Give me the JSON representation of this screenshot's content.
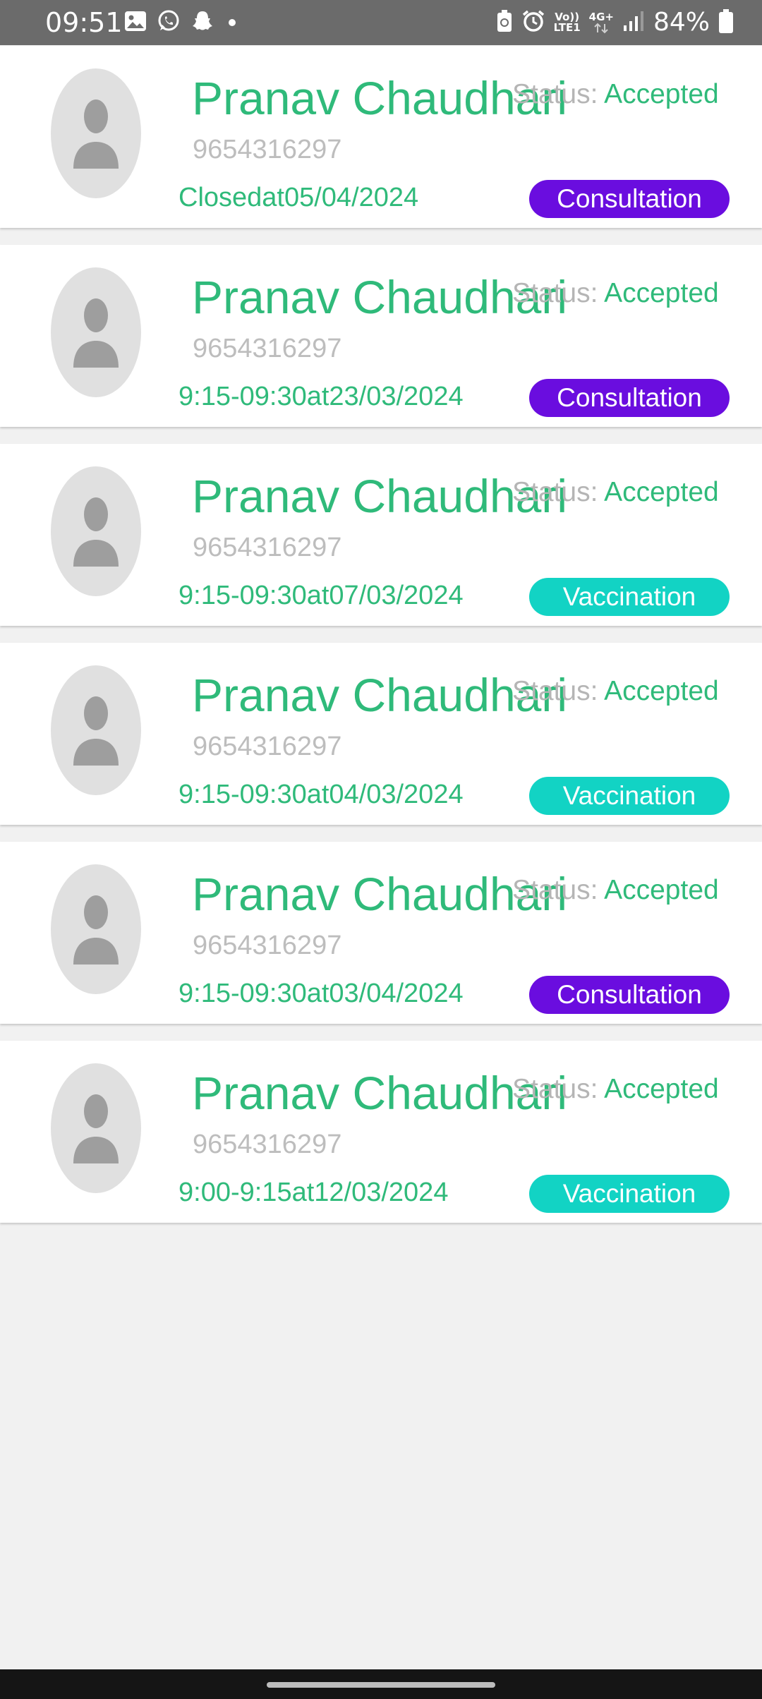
{
  "status_bar": {
    "time": "09:51",
    "battery": "84%",
    "volte_label": "Vo))",
    "lte_label": "LTE1",
    "network_label": "4G+"
  },
  "appointments": [
    {
      "name": "Pranav Chaudhari",
      "phone": "9654316297",
      "status_label": "Status:",
      "status_value": "Accepted",
      "time": "Closedat05/04/2024",
      "type": "Consultation",
      "type_color": "#6a0ddf"
    },
    {
      "name": "Pranav Chaudhari",
      "phone": "9654316297",
      "status_label": "Status:",
      "status_value": "Accepted",
      "time": "9:15-09:30at23/03/2024",
      "type": "Consultation",
      "type_color": "#6a0ddf"
    },
    {
      "name": "Pranav Chaudhari",
      "phone": "9654316297",
      "status_label": "Status:",
      "status_value": "Accepted",
      "time": "9:15-09:30at07/03/2024",
      "type": "Vaccination",
      "type_color": "#12d3c4"
    },
    {
      "name": "Pranav Chaudhari",
      "phone": "9654316297",
      "status_label": "Status:",
      "status_value": "Accepted",
      "time": "9:15-09:30at04/03/2024",
      "type": "Vaccination",
      "type_color": "#12d3c4"
    },
    {
      "name": "Pranav Chaudhari",
      "phone": "9654316297",
      "status_label": "Status:",
      "status_value": "Accepted",
      "time": "9:15-09:30at03/04/2024",
      "type": "Consultation",
      "type_color": "#6a0ddf"
    },
    {
      "name": "Pranav Chaudhari",
      "phone": "9654316297",
      "status_label": "Status:",
      "status_value": "Accepted",
      "time": "9:00-9:15at12/03/2024",
      "type": "Vaccination",
      "type_color": "#12d3c4"
    }
  ],
  "colors": {
    "accent_green": "#2fba7a",
    "consultation": "#6a0ddf",
    "vaccination": "#12d3c4"
  }
}
